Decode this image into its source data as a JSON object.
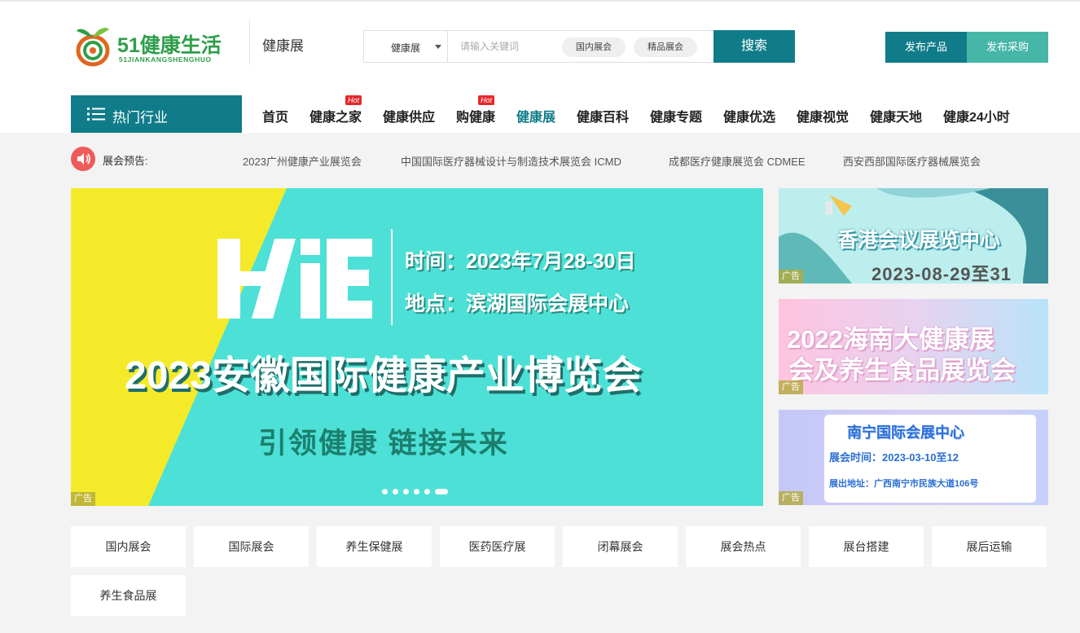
{
  "site": {
    "logo_text": "51健康生活",
    "logo_sub": "51JIANKANGSHENGHUO",
    "channel_title": "健康展"
  },
  "search": {
    "select_value": "健康展",
    "placeholder": "请输入关键词",
    "tags": [
      "国内展会",
      "精品展会"
    ],
    "button": "搜索"
  },
  "actions": {
    "publish_product": "发布产品",
    "publish_purchase": "发布采购"
  },
  "nav": {
    "hot_industry": "热门行业",
    "items": [
      {
        "label": "首页",
        "hot": false,
        "active": false
      },
      {
        "label": "健康之家",
        "hot": true,
        "active": false
      },
      {
        "label": "健康供应",
        "hot": false,
        "active": false
      },
      {
        "label": "购健康",
        "hot": true,
        "active": false
      },
      {
        "label": "健康展",
        "hot": false,
        "active": true
      },
      {
        "label": "健康百科",
        "hot": false,
        "active": false
      },
      {
        "label": "健康专题",
        "hot": false,
        "active": false
      },
      {
        "label": "健康优选",
        "hot": false,
        "active": false
      },
      {
        "label": "健康视觉",
        "hot": false,
        "active": false
      },
      {
        "label": "健康天地",
        "hot": false,
        "active": false
      },
      {
        "label": "健康24小时",
        "hot": false,
        "active": false
      }
    ],
    "hot_badge": "Hot"
  },
  "ticker": {
    "label": "展会预告:",
    "items": [
      "2023广州健康产业展览会",
      "中国国际医疗器械设计与制造技术展览会 ICMD",
      "成都医疗健康展览会 CDMEE",
      "西安西部国际医疗器械展览会"
    ]
  },
  "banner": {
    "logo_text": "HiE",
    "time": "时间：2023年7月28-30日",
    "place": "地点：滨湖国际会展中心",
    "title": "2023安徽国际健康产业博览会",
    "slogan": "引领健康  链接未来",
    "ad_label": "广告",
    "slides_count": 6,
    "active_slide": 5
  },
  "side_ads": [
    {
      "title": "香港会议展览中心",
      "date": "2023-08-29至31",
      "ad_label": "广告"
    },
    {
      "line1": "2022海南大健康展",
      "line2": "会及养生食品展览会",
      "ad_label": "广告"
    },
    {
      "title": "南宁国际会展中心",
      "time": "展会时间：2023-03-10至12",
      "addr": "展出地址：广西南宁市民族大道106号",
      "ad_label": "广告"
    }
  ],
  "categories": [
    "国内展会",
    "国际展会",
    "养生保健展",
    "医药医疗展",
    "闭幕展会",
    "展会热点",
    "展台搭建",
    "展后运输",
    "养生食品展"
  ],
  "colors": {
    "primary": "#117c89",
    "secondary": "#45b6a8",
    "hot": "#e4272b",
    "banner_bg": "#4de0d6",
    "banner_yellow": "#f5ea2a"
  }
}
